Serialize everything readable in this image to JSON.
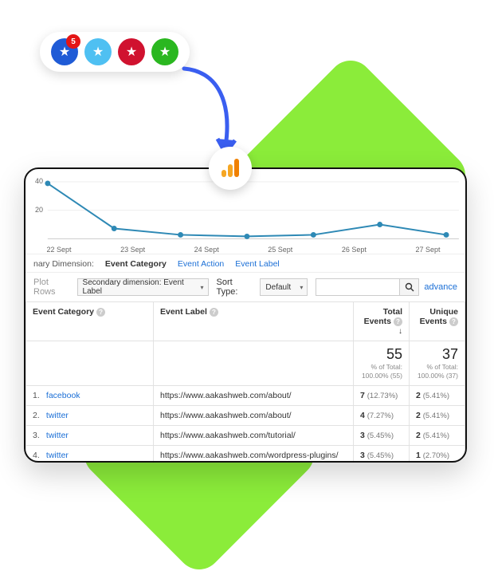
{
  "pill": {
    "colors": [
      "#1f5bd6",
      "#4fc0f2",
      "#d0122f",
      "#2ab720"
    ],
    "badge": "5"
  },
  "chart_data": {
    "type": "line",
    "categories": [
      "22 Sept",
      "23 Sept",
      "24 Sept",
      "25 Sept",
      "26 Sept",
      "27 Sept"
    ],
    "values": [
      38,
      7,
      3,
      2,
      3,
      10,
      3
    ],
    "ylim": [
      0,
      40
    ],
    "yticks": [
      20,
      40
    ]
  },
  "dimension": {
    "label": "nary Dimension:",
    "primary_value": "Event Category",
    "links": [
      "Event Action",
      "Event Label"
    ]
  },
  "controls": {
    "plot_rows": "Plot Rows",
    "secondary_label": "Secondary dimension: Event Label",
    "sort_type_label": "Sort Type:",
    "sort_type_value": "Default",
    "advanced": "advance"
  },
  "table": {
    "headers": {
      "category": "Event Category",
      "label": "Event Label",
      "total": "Total Events",
      "unique": "Unique Events"
    },
    "totals": {
      "total_big": "55",
      "total_sub1": "% of Total:",
      "total_sub2": "100.00% (55)",
      "unique_big": "37",
      "unique_sub1": "% of Total:",
      "unique_sub2": "100.00% (37)"
    },
    "rows": [
      {
        "idx": "1.",
        "cat": "facebook",
        "label": "https://www.aakashweb.com/about/",
        "t_n": "7",
        "t_p": "(12.73%)",
        "u_n": "2",
        "u_p": "(5.41%)"
      },
      {
        "idx": "2.",
        "cat": "twitter",
        "label": "https://www.aakashweb.com/about/",
        "t_n": "4",
        "t_p": "(7.27%)",
        "u_n": "2",
        "u_p": "(5.41%)"
      },
      {
        "idx": "3.",
        "cat": "twitter",
        "label": "https://www.aakashweb.com/tutorial/",
        "t_n": "3",
        "t_p": "(5.45%)",
        "u_n": "2",
        "u_p": "(5.41%)"
      },
      {
        "idx": "4.",
        "cat": "twitter",
        "label": "https://www.aakashweb.com/wordpress-plugins/",
        "t_n": "3",
        "t_p": "(5.45%)",
        "u_n": "1",
        "u_p": "(2.70%)"
      }
    ]
  }
}
